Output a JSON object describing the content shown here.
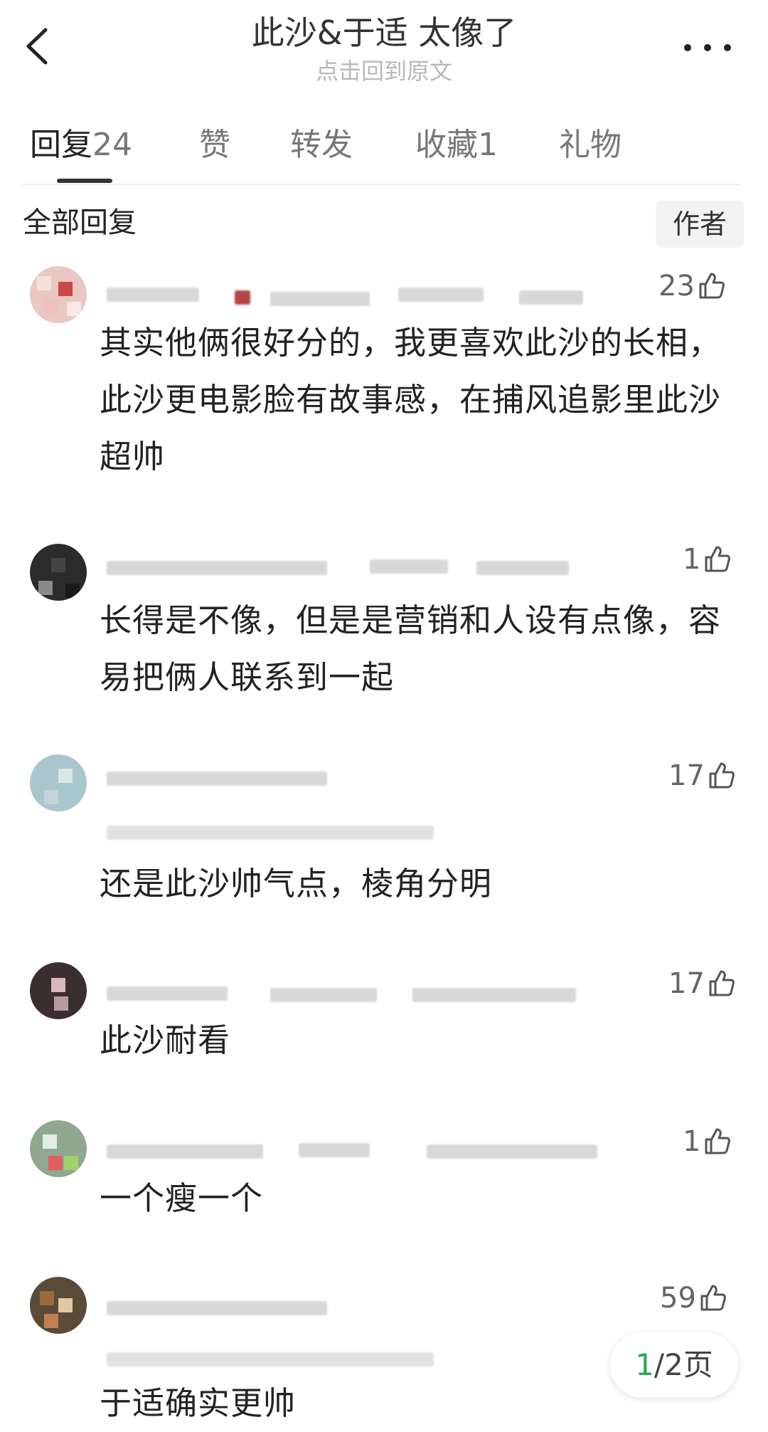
{
  "header": {
    "title": "此沙&于适 太像了",
    "subtitle": "点击回到原文"
  },
  "tabs": [
    {
      "label": "回复",
      "count": "24"
    },
    {
      "label": "赞"
    },
    {
      "label": "转发"
    },
    {
      "label": "收藏",
      "count": "1"
    },
    {
      "label": "礼物"
    }
  ],
  "section": {
    "label": "全部回复",
    "author_filter": "作者"
  },
  "comments": [
    {
      "likes": "23",
      "text": "其实他俩很好分的，我更喜欢此沙的长相，此沙更电影脸有故事感，在捕风追影里此沙超帅"
    },
    {
      "likes": "1",
      "text": "长得是不像，但是是营销和人设有点像，容易把俩人联系到一起"
    },
    {
      "likes": "17",
      "text": "还是此沙帅气点，棱角分明"
    },
    {
      "likes": "17",
      "text": "此沙耐看"
    },
    {
      "likes": "1",
      "text": "一个瘦一个"
    },
    {
      "likes": "59",
      "text": "于适确实更帅"
    }
  ],
  "pager": {
    "current": "1",
    "total_label": "/2页"
  },
  "colors": {
    "accent_green": "#2aa757",
    "muted": "#b8b8b8"
  },
  "icons": {
    "back": "chevron-left-icon",
    "more": "more-dots-icon",
    "like": "thumbs-up-icon"
  }
}
